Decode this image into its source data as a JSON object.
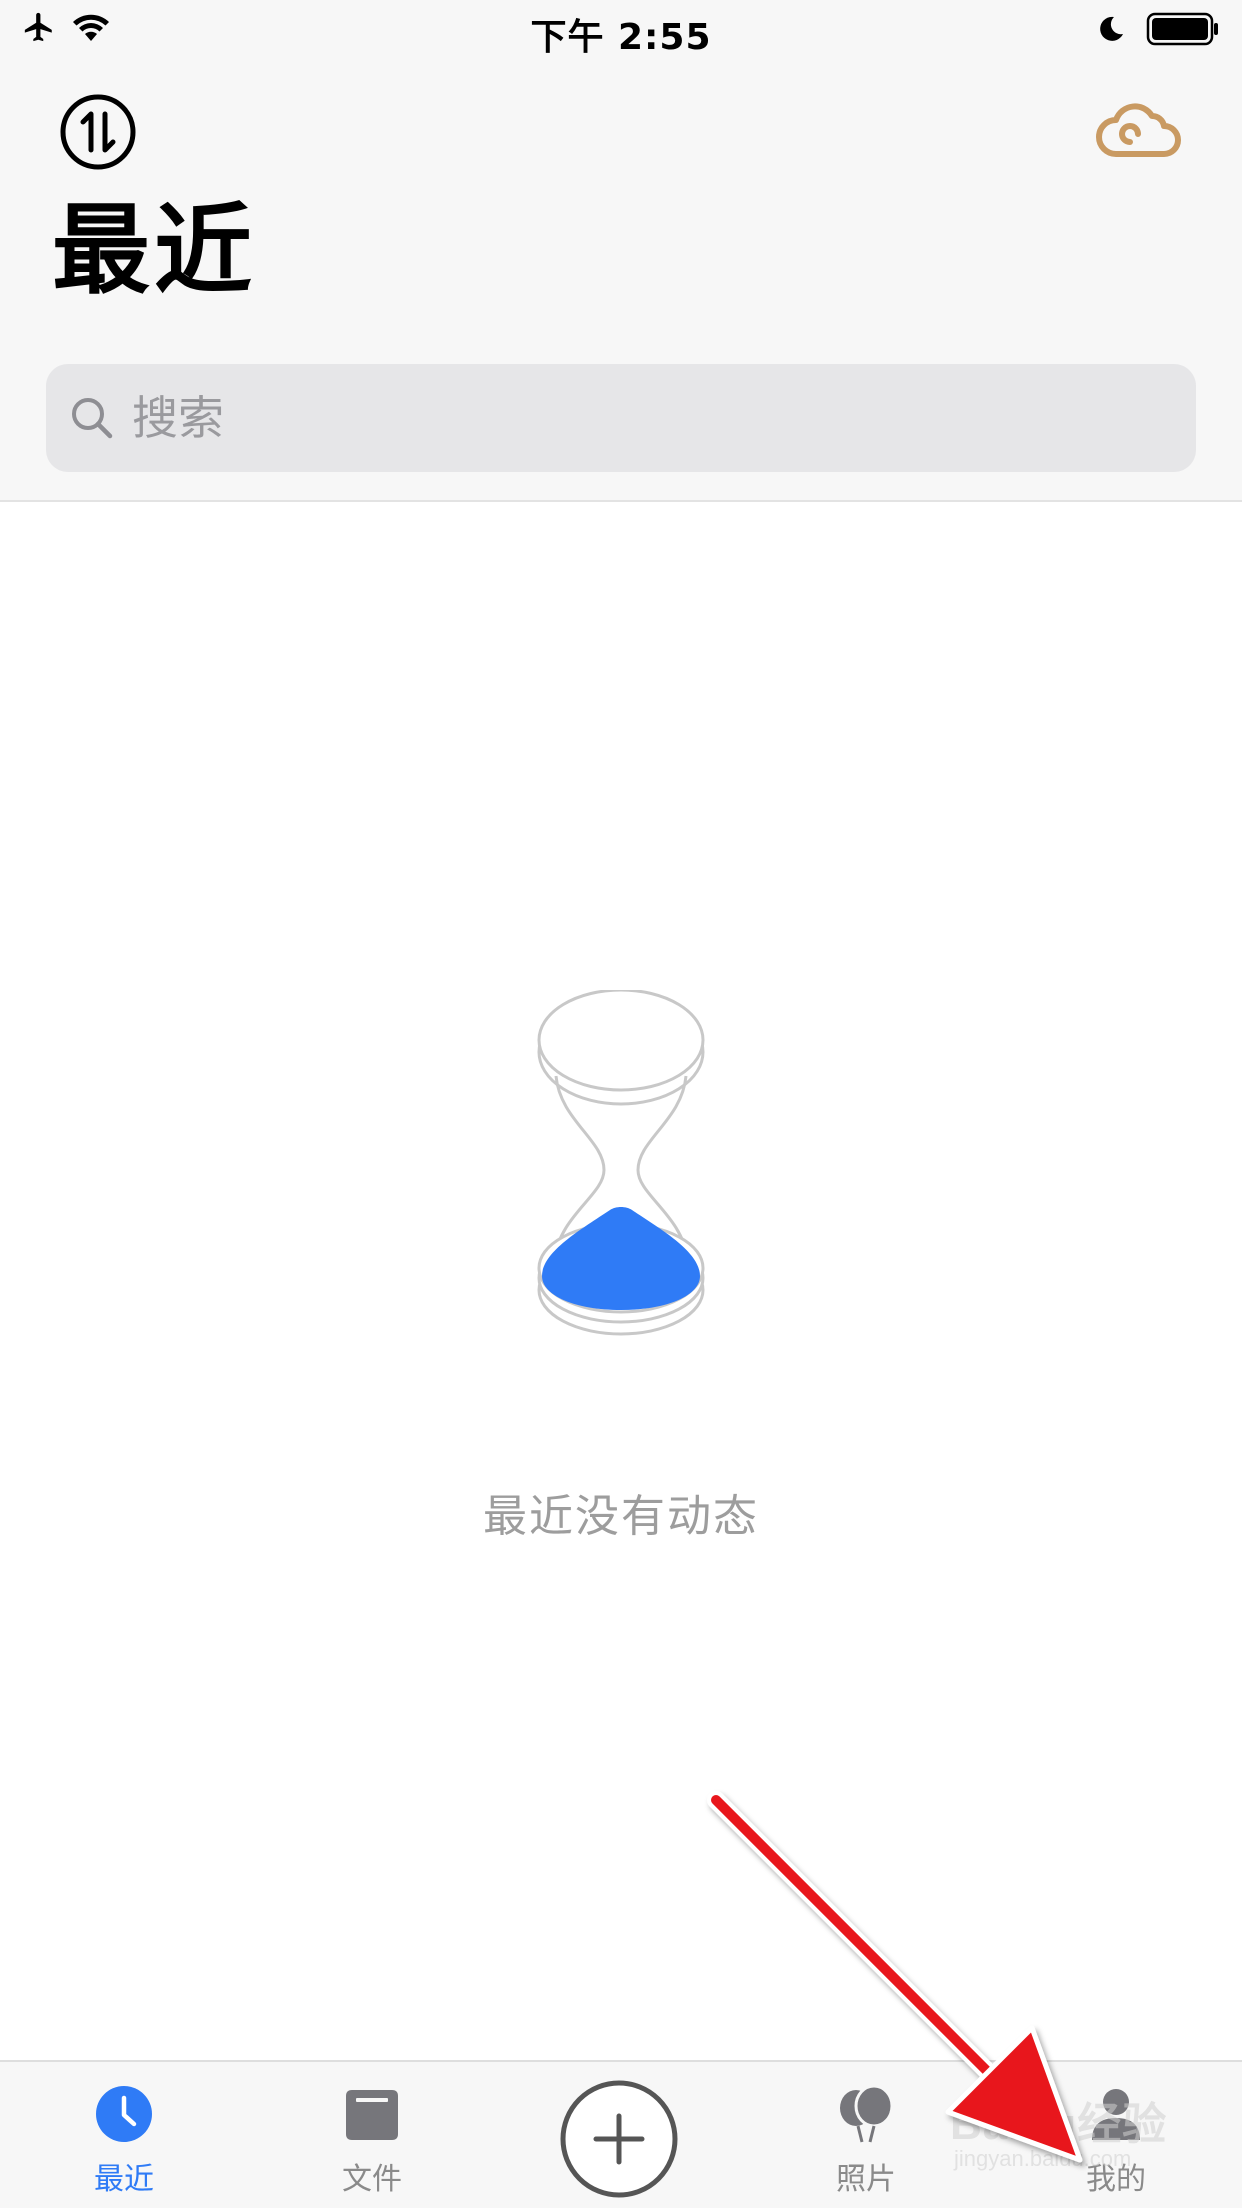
{
  "status_bar": {
    "time": "下午 2:55"
  },
  "header": {
    "title": "最近",
    "sync_icon": "transfer-icon",
    "cloud_icon": "cloud-icon",
    "cloud_color": "#c99a62"
  },
  "search": {
    "placeholder": "搜索",
    "value": ""
  },
  "empty_state": {
    "icon": "hourglass-icon",
    "message": "最近没有动态",
    "accent_color": "#2f7bf6"
  },
  "tab_bar": {
    "active_color": "#2f7bf6",
    "inactive_color": "#8a8a8a",
    "tabs": [
      {
        "label": "最近",
        "icon": "clock-icon",
        "active": true
      },
      {
        "label": "文件",
        "icon": "folder-icon",
        "active": false
      },
      {
        "label": "照片",
        "icon": "balloons-icon",
        "active": false
      },
      {
        "label": "我的",
        "icon": "person-icon",
        "active": false
      }
    ],
    "add_icon": "plus-icon"
  },
  "watermark": {
    "brand": "Baidu经验",
    "url": "jingyan.baidu.com"
  }
}
